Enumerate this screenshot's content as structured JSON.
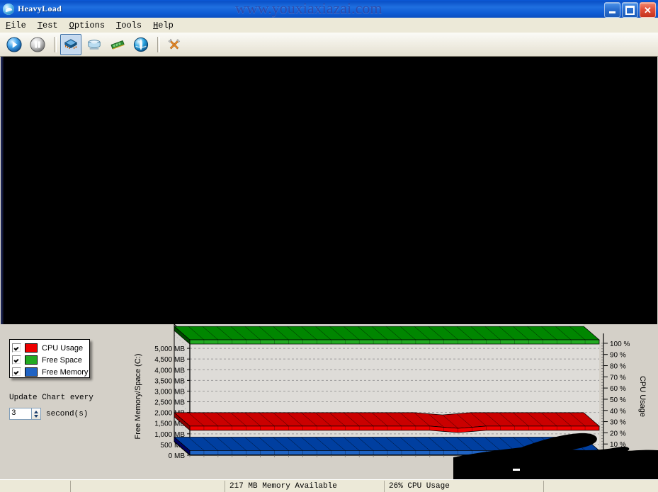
{
  "window": {
    "title": "HeavyLoad",
    "icon": "heavyload-logo-icon",
    "watermark": "www.youxiaxiazai.com",
    "buttons": {
      "minimize": "minimize-button",
      "maximize": "maximize-button",
      "close": "close-button"
    }
  },
  "menu": [
    {
      "label": "File",
      "mnemonic": "F"
    },
    {
      "label": "Test",
      "mnemonic": "T"
    },
    {
      "label": "Options",
      "mnemonic": "O"
    },
    {
      "label": "Tools",
      "mnemonic": "T"
    },
    {
      "label": "Help",
      "mnemonic": "H"
    }
  ],
  "toolbar": [
    {
      "name": "start-test-button",
      "icon": "play-icon",
      "selected": false
    },
    {
      "name": "pause-test-button",
      "icon": "pause-icon",
      "selected": false
    },
    {
      "name": "stress-cpu-button",
      "icon": "cpu-chip-icon",
      "selected": true
    },
    {
      "name": "stress-disk-button",
      "icon": "hard-disk-icon",
      "selected": false
    },
    {
      "name": "stress-memory-button",
      "icon": "memory-module-icon",
      "selected": false
    },
    {
      "name": "stress-network-button",
      "icon": "globe-icon",
      "selected": false
    },
    {
      "name": "options-button",
      "icon": "tools-icon",
      "selected": false
    }
  ],
  "legend": {
    "items": [
      {
        "label": "CPU Usage",
        "color": "#ee0000",
        "checked": true
      },
      {
        "label": "Free Space",
        "color": "#22aa22",
        "checked": true
      },
      {
        "label": "Free Memory",
        "color": "#1f63c4",
        "checked": true
      }
    ]
  },
  "update_chart": {
    "label": "Update Chart every",
    "value": "3",
    "unit": "second(s)"
  },
  "statusbar": {
    "cells": [
      "",
      "",
      "217 MB Memory Available",
      "26% CPU Usage",
      ""
    ]
  },
  "chart_data": {
    "type": "area",
    "title": "",
    "ylabel": "Free Memory/Space (C:)",
    "y2label": "CPU Usage",
    "xlabel": "",
    "grid": true,
    "legend_position": "outside-left",
    "ylim": [
      0,
      5500
    ],
    "y_ticks": [
      "0 MB",
      "500 MB",
      "1,000 MB",
      "1,500 MB",
      "2,000 MB",
      "2,500 MB",
      "3,000 MB",
      "3,500 MB",
      "4,000 MB",
      "4,500 MB",
      "5,000 MB"
    ],
    "y_tick_values": [
      0,
      500,
      1000,
      1500,
      2000,
      2500,
      3000,
      3500,
      4000,
      4500,
      5000
    ],
    "y2lim": [
      0,
      105
    ],
    "y2_ticks": [
      "10 %",
      "20 %",
      "30 %",
      "40 %",
      "50 %",
      "60 %",
      "70 %",
      "80 %",
      "90 %",
      "100 %"
    ],
    "y2_tick_values": [
      10,
      20,
      30,
      40,
      50,
      60,
      70,
      80,
      90,
      100
    ],
    "x": [
      1,
      2,
      3,
      4,
      5,
      6,
      7,
      8,
      9,
      10,
      11,
      12,
      13,
      14,
      15,
      16,
      17,
      18,
      19,
      20,
      21,
      22,
      23,
      24,
      25,
      26,
      27,
      28,
      29,
      30
    ],
    "series": [
      {
        "name": "Free Space",
        "color": "#22aa22",
        "axis": "left",
        "unit": "MB",
        "values": [
          5400,
          5400,
          5400,
          5400,
          5400,
          5400,
          5400,
          5400,
          5400,
          5400,
          5400,
          5400,
          5400,
          5400,
          5400,
          5400,
          5400,
          5400,
          5400,
          5400,
          5400,
          5400,
          5400,
          5400,
          5400,
          5400,
          5400,
          5400,
          5400,
          5400
        ]
      },
      {
        "name": "CPU Usage",
        "color": "#ee0000",
        "axis": "right",
        "unit": "%",
        "values": [
          26,
          26,
          26,
          26,
          26,
          26,
          26,
          26,
          26,
          26,
          26,
          26,
          26,
          26,
          26,
          26,
          26,
          26,
          25,
          24,
          25,
          26,
          26,
          26,
          26,
          26,
          26,
          26,
          26,
          26
        ]
      },
      {
        "name": "Free Memory",
        "color": "#1f63c4",
        "axis": "left",
        "unit": "MB",
        "values": [
          217,
          217,
          217,
          217,
          217,
          217,
          217,
          217,
          217,
          217,
          217,
          217,
          217,
          217,
          217,
          217,
          217,
          217,
          217,
          217,
          217,
          217,
          217,
          217,
          217,
          217,
          217,
          217,
          217,
          217
        ]
      }
    ]
  }
}
